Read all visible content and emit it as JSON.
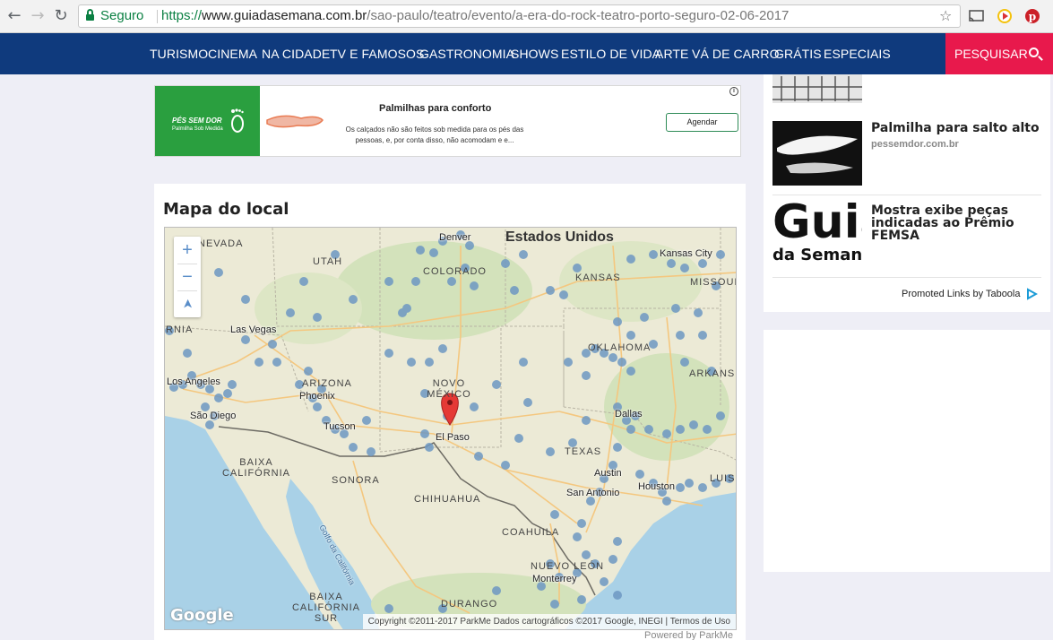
{
  "browser": {
    "secure_label": "Seguro",
    "url_scheme": "https://",
    "url_host": "www.guiadasemana.com.br",
    "url_path": "/sao-paulo/teatro/evento/a-era-do-rock-teatro-porto-seguro-02-06-2017",
    "back_icon": "←",
    "forward_icon": "→",
    "reload_icon": "↻",
    "star_icon": "☆"
  },
  "nav": {
    "items": [
      "TURISMO",
      "CINEMA",
      "NA CIDADE",
      "TV E FAMOSOS",
      "GASTRONOMIA",
      "SHOWS",
      "ESTILO DE VIDA",
      "ARTE",
      "VÁ DE CARRO",
      "GRÁTIS",
      "ESPECIAIS"
    ],
    "search_label": "PESQUISAR",
    "color_bg": "#0f3a7d",
    "color_search": "#e8194c"
  },
  "ad": {
    "logo_brand": "PÉS SEM DOR",
    "logo_sub": "Palmilha Sob Medida",
    "title": "Palmilhas para conforto",
    "text": "Os calçados não são feitos sob medida para os pés das pessoas, e, por conta disso, não acomodam e e...",
    "button": "Agendar",
    "info_icon": "i"
  },
  "map_section": {
    "heading": "Mapa do local",
    "zoom_in": "+",
    "zoom_out": "−",
    "locate_icon": "➤",
    "country": "Estados Unidos",
    "regions": [
      "NEVADA",
      "UTAH",
      "COLORADO",
      "KANSAS",
      "MISSOUI",
      "ARIZONA",
      "NOVO MÉXICO",
      "OKLAHOMA",
      "ARKANS",
      "TEXAS",
      "SONORA",
      "CHIHUAHUA",
      "COAHUILA",
      "BAIXA CALIFÓRNIA",
      "NUEVO LEÓN",
      "BAIXA CALIFÓRNIA SUR",
      "DURANGO",
      "LUISI",
      "RNIA"
    ],
    "cities": [
      "Denver",
      "Kansas City",
      "Las Vegas",
      "Los Angeles",
      "Phoenix",
      "São Diego",
      "Tucson",
      "El Paso",
      "Dallas",
      "Austin",
      "San Antonio",
      "Houston",
      "Monterrey"
    ],
    "water_label": "Golfo da Califórnia",
    "google": "Google",
    "attribution": "Copyright ©2011-2017 ParkMe  Dados cartográficos ©2017 Google, INEGI  |  Termos de Uso",
    "powered": "Powered by ParkMe"
  },
  "sidebar": {
    "items": [
      {
        "title": "Palmilha para salto alto",
        "source": "pessemdor.com.br"
      },
      {
        "title": "Mostra exibe peças indicadas ao Prêmio FEMSA",
        "source": ""
      }
    ],
    "guia_logo_top": "Guia",
    "guia_logo_bottom": "da Semana",
    "promoted": "Promoted Links by Taboola"
  }
}
